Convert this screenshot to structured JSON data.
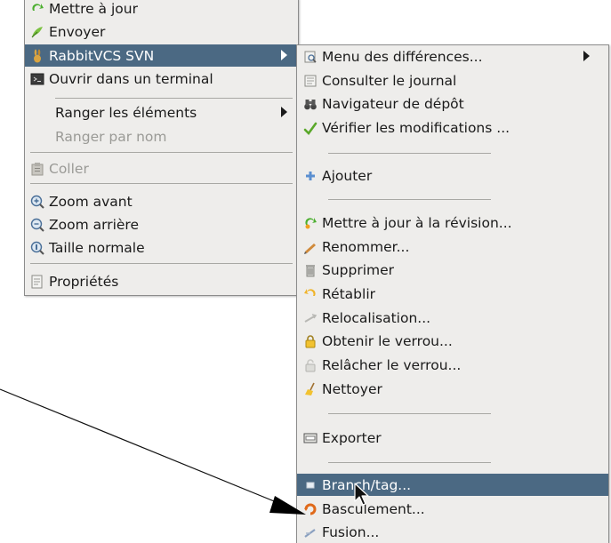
{
  "left_menu": {
    "items": [
      {
        "label": "Mettre à jour"
      },
      {
        "label": "Envoyer"
      },
      {
        "label": "RabbitVCS SVN"
      },
      {
        "label": "Ouvrir dans un terminal"
      },
      {
        "label": "Ranger les éléments"
      },
      {
        "label": "Ranger par nom"
      },
      {
        "label": "Coller"
      },
      {
        "label": "Zoom avant"
      },
      {
        "label": "Zoom arrière"
      },
      {
        "label": "Taille normale"
      },
      {
        "label": "Propriétés"
      }
    ]
  },
  "right_menu": {
    "items": [
      {
        "label": "Menu des différences..."
      },
      {
        "label": "Consulter le journal"
      },
      {
        "label": "Navigateur de dépôt"
      },
      {
        "label": "Vérifier les modifications ..."
      },
      {
        "label": "Ajouter"
      },
      {
        "label": "Mettre à jour à la révision..."
      },
      {
        "label": "Renommer..."
      },
      {
        "label": "Supprimer"
      },
      {
        "label": "Rétablir"
      },
      {
        "label": "Relocalisation..."
      },
      {
        "label": "Obtenir le verrou..."
      },
      {
        "label": "Relâcher le verrou..."
      },
      {
        "label": "Nettoyer"
      },
      {
        "label": "Exporter"
      },
      {
        "label": "Branch/tag..."
      },
      {
        "label": "Basculement..."
      },
      {
        "label": "Fusion..."
      }
    ]
  },
  "colors": {
    "menu_bg": "#eeedeb",
    "selection": "#4b6983",
    "disabled_text": "#9a9a96"
  }
}
